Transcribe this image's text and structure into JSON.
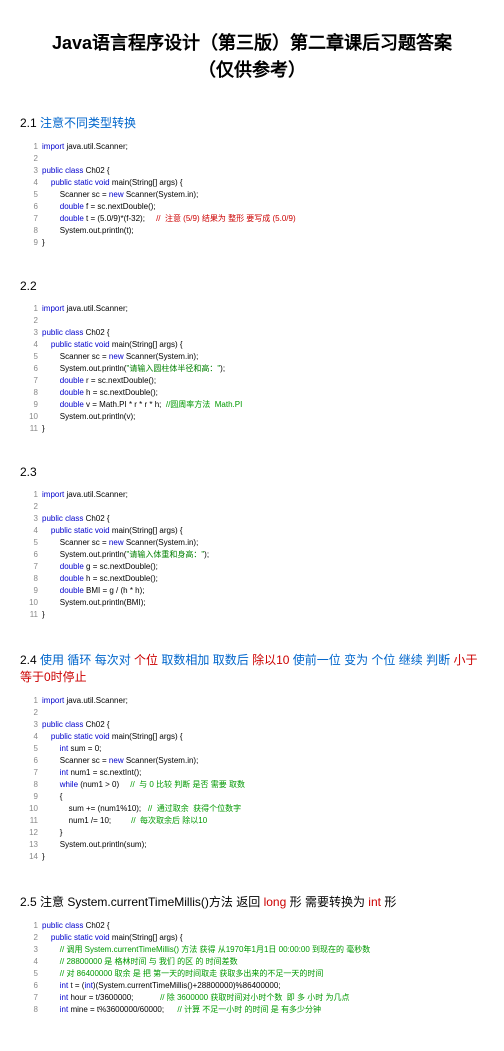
{
  "title": "Java语言程序设计（第三版）第二章课后习题答案（仅供参考）",
  "sections": [
    {
      "num": "2.1",
      "text": "注意不同类型转换",
      "text_red": "",
      "lines": [
        {
          "n": "1",
          "p": [
            [
              "kw",
              "import"
            ],
            [
              "txt",
              " java.util.Scanner;"
            ]
          ]
        },
        {
          "n": "2",
          "p": []
        },
        {
          "n": "3",
          "p": [
            [
              "kw",
              "public class"
            ],
            [
              "txt",
              " Ch02 {"
            ]
          ]
        },
        {
          "n": "4",
          "p": [
            [
              "txt",
              "    "
            ],
            [
              "kw",
              "public static void"
            ],
            [
              "txt",
              " main(String[] args) {"
            ]
          ]
        },
        {
          "n": "5",
          "p": [
            [
              "txt",
              "        Scanner sc = "
            ],
            [
              "kw",
              "new"
            ],
            [
              "txt",
              " Scanner(System.in);"
            ]
          ]
        },
        {
          "n": "6",
          "p": [
            [
              "txt",
              "        "
            ],
            [
              "kw",
              "double"
            ],
            [
              "txt",
              " f = sc.nextDouble();"
            ]
          ]
        },
        {
          "n": "7",
          "p": [
            [
              "txt",
              "        "
            ],
            [
              "kw",
              "double"
            ],
            [
              "txt",
              " t = (5.0/9)*(f-32);     "
            ],
            [
              "cmt-red",
              "//  注意 (5/9) 结果为 整形 要写成 (5.0/9)"
            ]
          ]
        },
        {
          "n": "8",
          "p": [
            [
              "txt",
              "        System.out.println(t);"
            ]
          ]
        },
        {
          "n": "9",
          "p": [
            [
              "txt",
              "}"
            ]
          ]
        }
      ]
    },
    {
      "num": "2.2",
      "text": "",
      "text_red": "",
      "lines": [
        {
          "n": "1",
          "p": [
            [
              "kw",
              "import"
            ],
            [
              "txt",
              " java.util.Scanner;"
            ]
          ]
        },
        {
          "n": "2",
          "p": []
        },
        {
          "n": "3",
          "p": [
            [
              "kw",
              "public class"
            ],
            [
              "txt",
              " Ch02 {"
            ]
          ]
        },
        {
          "n": "4",
          "p": [
            [
              "txt",
              "    "
            ],
            [
              "kw",
              "public static void"
            ],
            [
              "txt",
              " main(String[] args) {"
            ]
          ]
        },
        {
          "n": "5",
          "p": [
            [
              "txt",
              "        Scanner sc = "
            ],
            [
              "kw",
              "new"
            ],
            [
              "txt",
              " Scanner(System.in);"
            ]
          ]
        },
        {
          "n": "6",
          "p": [
            [
              "txt",
              "        System.out.println("
            ],
            [
              "str",
              "\"请输入圆柱体半径和高：\""
            ],
            [
              "txt",
              ");"
            ]
          ]
        },
        {
          "n": "7",
          "p": [
            [
              "txt",
              "        "
            ],
            [
              "kw",
              "double"
            ],
            [
              "txt",
              " r = sc.nextDouble();"
            ]
          ]
        },
        {
          "n": "8",
          "p": [
            [
              "txt",
              "        "
            ],
            [
              "kw",
              "double"
            ],
            [
              "txt",
              " h = sc.nextDouble();"
            ]
          ]
        },
        {
          "n": "9",
          "p": [
            [
              "txt",
              "        "
            ],
            [
              "kw",
              "double"
            ],
            [
              "txt",
              " v = Math.PI * r * r * h;  "
            ],
            [
              "cmt-green",
              "//圆周率方法  Math.PI"
            ]
          ]
        },
        {
          "n": "10",
          "p": [
            [
              "txt",
              "        System.out.println(v);"
            ]
          ]
        },
        {
          "n": "11",
          "p": [
            [
              "txt",
              "}"
            ]
          ]
        }
      ]
    },
    {
      "num": "2.3",
      "text": "",
      "text_red": "",
      "lines": [
        {
          "n": "1",
          "p": [
            [
              "kw",
              "import"
            ],
            [
              "txt",
              " java.util.Scanner;"
            ]
          ]
        },
        {
          "n": "2",
          "p": []
        },
        {
          "n": "3",
          "p": [
            [
              "kw",
              "public class"
            ],
            [
              "txt",
              " Ch02 {"
            ]
          ]
        },
        {
          "n": "4",
          "p": [
            [
              "txt",
              "    "
            ],
            [
              "kw",
              "public static void"
            ],
            [
              "txt",
              " main(String[] args) {"
            ]
          ]
        },
        {
          "n": "5",
          "p": [
            [
              "txt",
              "        Scanner sc = "
            ],
            [
              "kw",
              "new"
            ],
            [
              "txt",
              " Scanner(System.in);"
            ]
          ]
        },
        {
          "n": "6",
          "p": [
            [
              "txt",
              "        System.out.println("
            ],
            [
              "str",
              "\"请输入体重和身高：\""
            ],
            [
              "txt",
              ");"
            ]
          ]
        },
        {
          "n": "7",
          "p": [
            [
              "txt",
              "        "
            ],
            [
              "kw",
              "double"
            ],
            [
              "txt",
              " g = sc.nextDouble();"
            ]
          ]
        },
        {
          "n": "8",
          "p": [
            [
              "txt",
              "        "
            ],
            [
              "kw",
              "double"
            ],
            [
              "txt",
              " h = sc.nextDouble();"
            ]
          ]
        },
        {
          "n": "9",
          "p": [
            [
              "txt",
              "        "
            ],
            [
              "kw",
              "double"
            ],
            [
              "txt",
              " BMI = g / (h * h);"
            ]
          ]
        },
        {
          "n": "10",
          "p": [
            [
              "txt",
              "        System.out.println(BMI);"
            ]
          ]
        },
        {
          "n": "11",
          "p": [
            [
              "txt",
              "}"
            ]
          ]
        }
      ]
    },
    {
      "num": "2.4",
      "text_parts": [
        {
          "c": "blue",
          "t": " 使用 循环 每次对 "
        },
        {
          "c": "red",
          "t": "个位"
        },
        {
          "c": "blue",
          "t": " 取数相加 取数后 "
        },
        {
          "c": "red",
          "t": "除以10"
        },
        {
          "c": "blue",
          "t": " 使前一位 变为 个位 继续 判断 "
        },
        {
          "c": "red",
          "t": "小于等于0时停止"
        }
      ],
      "lines": [
        {
          "n": "1",
          "p": [
            [
              "kw",
              "import"
            ],
            [
              "txt",
              " java.util.Scanner;"
            ]
          ]
        },
        {
          "n": "2",
          "p": []
        },
        {
          "n": "3",
          "p": [
            [
              "kw",
              "public class"
            ],
            [
              "txt",
              " Ch02 {"
            ]
          ]
        },
        {
          "n": "4",
          "p": [
            [
              "txt",
              "    "
            ],
            [
              "kw",
              "public static void"
            ],
            [
              "txt",
              " main(String[] args) {"
            ]
          ]
        },
        {
          "n": "5",
          "p": [
            [
              "txt",
              "        "
            ],
            [
              "kw",
              "int"
            ],
            [
              "txt",
              " sum = 0;"
            ]
          ]
        },
        {
          "n": "6",
          "p": [
            [
              "txt",
              "        Scanner sc = "
            ],
            [
              "kw",
              "new"
            ],
            [
              "txt",
              " Scanner(System.in);"
            ]
          ]
        },
        {
          "n": "7",
          "p": [
            [
              "txt",
              "        "
            ],
            [
              "kw",
              "int"
            ],
            [
              "txt",
              " num1 = sc.nextInt();"
            ]
          ]
        },
        {
          "n": "8",
          "p": [
            [
              "txt",
              "        "
            ],
            [
              "kw",
              "while"
            ],
            [
              "txt",
              " (num1 > 0)     "
            ],
            [
              "cmt-green",
              "//  与 0 比较 判断 是否 需要 取数"
            ]
          ]
        },
        {
          "n": "9",
          "p": [
            [
              "txt",
              "        {"
            ]
          ]
        },
        {
          "n": "10",
          "p": [
            [
              "txt",
              "            sum += (num1%10);   "
            ],
            [
              "cmt-green",
              "//  通过取余  获得个位数字"
            ]
          ]
        },
        {
          "n": "11",
          "p": [
            [
              "txt",
              "            num1 /= 10;         "
            ],
            [
              "cmt-green",
              "//  每次取余后 除以10"
            ]
          ]
        },
        {
          "n": "12",
          "p": [
            [
              "txt",
              "        }"
            ]
          ]
        },
        {
          "n": "13",
          "p": [
            [
              "txt",
              "        System.out.println(sum);"
            ]
          ]
        },
        {
          "n": "14",
          "p": [
            [
              "txt",
              "}"
            ]
          ]
        }
      ]
    },
    {
      "num": "2.5",
      "text_parts": [
        {
          "c": "black",
          "t": " 注意 System.currentTimeMillis()方法 返回 "
        },
        {
          "c": "red",
          "t": "long"
        },
        {
          "c": "black",
          "t": " 形 需要转换为 "
        },
        {
          "c": "red",
          "t": "int"
        },
        {
          "c": "black",
          "t": " 形"
        }
      ],
      "lines": [
        {
          "n": "1",
          "p": [
            [
              "kw",
              "public class"
            ],
            [
              "txt",
              " Ch02 {"
            ]
          ]
        },
        {
          "n": "2",
          "p": [
            [
              "txt",
              "    "
            ],
            [
              "kw",
              "public static void"
            ],
            [
              "txt",
              " main(String[] args) {"
            ]
          ]
        },
        {
          "n": "3",
          "p": [
            [
              "txt",
              "        "
            ],
            [
              "cmt-green",
              "// 调用 System.currentTimeMillis() 方法 获得 从1970年1月1日 00:00:00 到现在的 毫秒数"
            ]
          ]
        },
        {
          "n": "4",
          "p": [
            [
              "txt",
              "        "
            ],
            [
              "cmt-green",
              "// 28800000 是 格林时间 与 我们 的区 的 时间差数"
            ]
          ]
        },
        {
          "n": "5",
          "p": [
            [
              "txt",
              "        "
            ],
            [
              "cmt-green",
              "// 对 86400000 取余 是 把 第一天的时间取走 获取多出来的不足一天的时间"
            ]
          ]
        },
        {
          "n": "6",
          "p": [
            [
              "txt",
              "        "
            ],
            [
              "kw",
              "int"
            ],
            [
              "txt",
              " t = ("
            ],
            [
              "kw",
              "int"
            ],
            [
              "txt",
              ")(System.currentTimeMillis()+28800000)%86400000;"
            ]
          ]
        },
        {
          "n": "7",
          "p": [
            [
              "txt",
              "        "
            ],
            [
              "kw",
              "int"
            ],
            [
              "txt",
              " hour = t/3600000;            "
            ],
            [
              "cmt-green",
              "// 除 3600000 获取时间对小时个数  即 多 小时 为几点"
            ]
          ]
        },
        {
          "n": "8",
          "p": [
            [
              "txt",
              "        "
            ],
            [
              "kw",
              "int"
            ],
            [
              "txt",
              " mine = t%3600000/60000;      "
            ],
            [
              "cmt-green",
              "// 计算 不足一小时 的时间 是 有多少分钟"
            ]
          ]
        }
      ]
    }
  ]
}
